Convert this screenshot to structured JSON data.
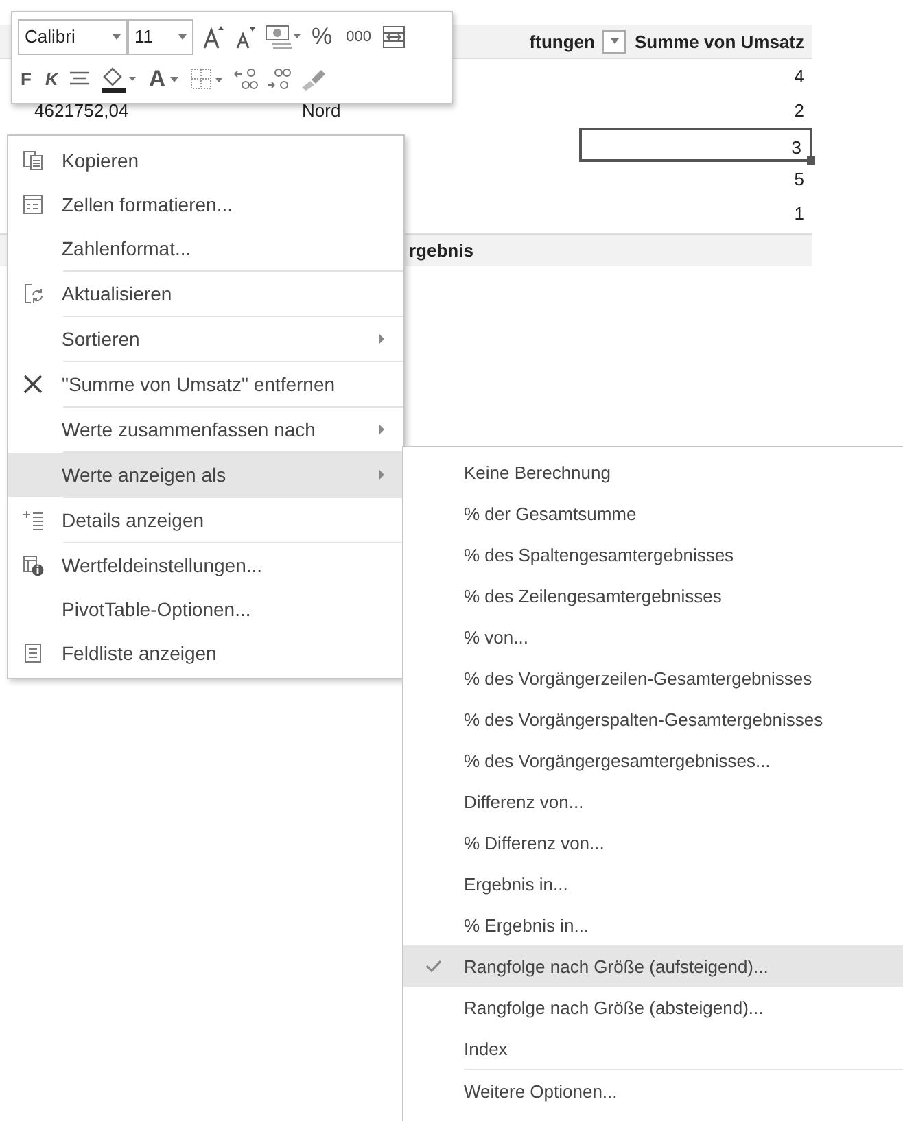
{
  "toolbar": {
    "font": "Calibri",
    "size": "11",
    "percent": "%",
    "thousands": "000",
    "bold": "F",
    "italic": "K",
    "font_color": "A"
  },
  "sheet": {
    "header": [
      "ftungen",
      "Summe von Umsatz"
    ],
    "rows": [
      {
        "value": "4",
        "selected": false
      },
      {
        "amount": "4621752,04",
        "region": "Nord",
        "value": "2",
        "selected": false
      },
      {
        "value": "3",
        "selected": true
      },
      {
        "value": "5",
        "selected": false
      },
      {
        "value": "1",
        "selected": false
      }
    ],
    "total": "rgebnis"
  },
  "context_menu": {
    "groups": [
      [
        {
          "label": "Kopieren",
          "kind": "copy",
          "submenu": false,
          "selected": false
        },
        {
          "label": "Zellen formatieren...",
          "kind": "format",
          "submenu": false,
          "selected": false
        },
        {
          "label": "Zahlenformat...",
          "submenu": false,
          "selected": false
        }
      ],
      [
        {
          "label": "Aktualisieren",
          "kind": "refresh",
          "submenu": false,
          "selected": false
        }
      ],
      [
        {
          "label": "Sortieren",
          "submenu": true,
          "selected": false
        }
      ],
      [
        {
          "label": "\"Summe von Umsatz\" entfernen",
          "kind": "remove",
          "submenu": false,
          "selected": false
        }
      ],
      [
        {
          "label": "Werte zusammenfassen nach",
          "submenu": true,
          "selected": false
        }
      ],
      [
        {
          "label": "Werte anzeigen als",
          "submenu": true,
          "selected": true
        }
      ],
      [
        {
          "label": "Details anzeigen",
          "kind": "details",
          "submenu": false,
          "selected": false
        }
      ],
      [
        {
          "label": "Wertfeldeinstellungen...",
          "kind": "settings",
          "submenu": false,
          "selected": false
        },
        {
          "label": "PivotTable-Optionen...",
          "submenu": false,
          "selected": false
        },
        {
          "label": "Feldliste anzeigen",
          "kind": "fieldlist",
          "submenu": false,
          "selected": false
        }
      ]
    ]
  },
  "submenu": {
    "groups": [
      [
        {
          "label": "Keine Berechnung",
          "checked": false,
          "selected": false
        },
        {
          "label": "% der Gesamtsumme",
          "checked": false,
          "selected": false
        },
        {
          "label": "% des Spaltengesamtergebnisses",
          "checked": false,
          "selected": false
        },
        {
          "label": "% des Zeilengesamtergebnisses",
          "checked": false,
          "selected": false
        },
        {
          "label": "% von...",
          "checked": false,
          "selected": false
        },
        {
          "label": "% des Vorgängerzeilen-Gesamtergebnisses",
          "checked": false,
          "selected": false
        },
        {
          "label": "% des Vorgängerspalten-Gesamtergebnisses",
          "checked": false,
          "selected": false
        },
        {
          "label": "% des Vorgängergesamtergebnisses...",
          "checked": false,
          "selected": false
        },
        {
          "label": "Differenz von...",
          "checked": false,
          "selected": false
        },
        {
          "label": "% Differenz von...",
          "checked": false,
          "selected": false
        },
        {
          "label": "Ergebnis in...",
          "checked": false,
          "selected": false
        },
        {
          "label": "% Ergebnis in...",
          "checked": false,
          "selected": false
        },
        {
          "label": "Rangfolge nach Größe (aufsteigend)...",
          "checked": true,
          "selected": true
        },
        {
          "label": "Rangfolge nach Größe (absteigend)...",
          "checked": false,
          "selected": false
        },
        {
          "label": "Index",
          "checked": false,
          "selected": false
        }
      ],
      [
        {
          "label": "Weitere Optionen...",
          "checked": false,
          "selected": false
        }
      ]
    ]
  }
}
